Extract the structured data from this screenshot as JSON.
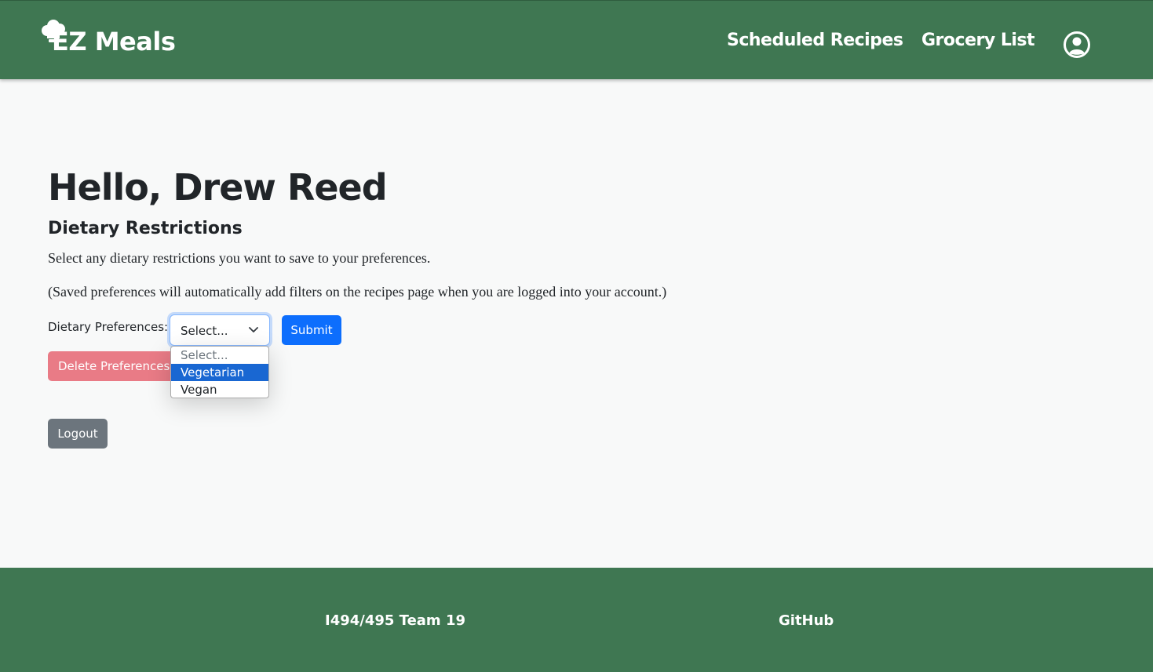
{
  "header": {
    "brand": "EZ Meals",
    "nav": {
      "scheduled_recipes": "Scheduled Recipes",
      "grocery_list": "Grocery List"
    },
    "icons": {
      "brand": "chef-hat-icon",
      "account": "user-circle-icon"
    },
    "background_color": "#3f7752"
  },
  "main": {
    "greeting": "Hello, Drew Reed",
    "section_title": "Dietary Restrictions",
    "paragraph_1": "Select any dietary restrictions you want to save to your preferences.",
    "paragraph_2": "(Saved preferences will automatically add filters on the recipes page when you are logged into your account.)",
    "preferences": {
      "label": "Dietary Preferences:",
      "select_value": "Select...",
      "options": [
        "Select...",
        "Vegetarian",
        "Vegan"
      ],
      "highlighted_option": "Vegetarian"
    },
    "buttons": {
      "submit": "Submit",
      "delete": "Delete Preferences",
      "logout": "Logout"
    },
    "colors": {
      "submit": "#0d6efd",
      "delete": "#e97b86",
      "logout": "#6c757d",
      "option_highlight": "#1967d2"
    }
  },
  "footer": {
    "team": "I494/495 Team 19",
    "github": "GitHub"
  }
}
